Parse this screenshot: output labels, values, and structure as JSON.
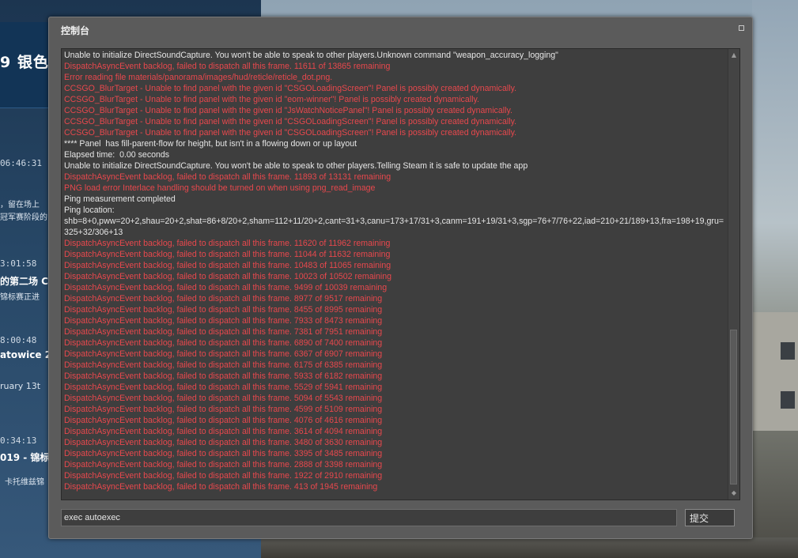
{
  "background": {
    "banner_text": "9 银色",
    "news": [
      {
        "time": "06:46:31",
        "title": "",
        "text": "，留在场上"
      },
      {
        "time": "",
        "title": "",
        "text": "冠军赛阶段的"
      },
      {
        "time": "3:01:58",
        "title": "的第二场 C",
        "text": "锦标赛正进"
      },
      {
        "time": "8:00:48",
        "title": "atowice 2",
        "text": "ruary 13t"
      },
      {
        "time": "0:34:13",
        "title": "019 - 锦标",
        "text": "卡托维兹锦"
      }
    ]
  },
  "console": {
    "title": "控制台",
    "log": [
      {
        "type": "info",
        "text": "Unable to initialize DirectSoundCapture. You won't be able to speak to other players.Unknown command \"weapon_accuracy_logging\""
      },
      {
        "type": "error",
        "text": "DispatchAsyncEvent backlog, failed to dispatch all this frame. 11611 of 13865 remaining"
      },
      {
        "type": "error",
        "text": "Error reading file materials/panorama/images/hud/reticle/reticle_dot.png."
      },
      {
        "type": "error",
        "text": "CCSGO_BlurTarget - Unable to find panel with the given id \"CSGOLoadingScreen\"! Panel is possibly created dynamically."
      },
      {
        "type": "error",
        "text": "CCSGO_BlurTarget - Unable to find panel with the given id \"eom-winner\"! Panel is possibly created dynamically."
      },
      {
        "type": "error",
        "text": "CCSGO_BlurTarget - Unable to find panel with the given id \"JsWatchNoticePanel\"! Panel is possibly created dynamically."
      },
      {
        "type": "error",
        "text": "CCSGO_BlurTarget - Unable to find panel with the given id \"CSGOLoadingScreen\"! Panel is possibly created dynamically."
      },
      {
        "type": "error",
        "text": "CCSGO_BlurTarget - Unable to find panel with the given id \"CSGOLoadingScreen\"! Panel is possibly created dynamically."
      },
      {
        "type": "info",
        "text": "**** Panel  has fill-parent-flow for height, but isn't in a flowing down or up layout"
      },
      {
        "type": "info",
        "text": "Elapsed time:  0.00 seconds"
      },
      {
        "type": "info",
        "text": "Unable to initialize DirectSoundCapture. You won't be able to speak to other players.Telling Steam it is safe to update the app"
      },
      {
        "type": "error",
        "text": "DispatchAsyncEvent backlog, failed to dispatch all this frame. 11893 of 13131 remaining"
      },
      {
        "type": "error",
        "text": "PNG load error Interlace handling should be turned on when using png_read_image"
      },
      {
        "type": "info",
        "text": "Ping measurement completed"
      },
      {
        "type": "info",
        "text": "Ping location:"
      },
      {
        "type": "info",
        "text": "shb=8+0,pww=20+2,shau=20+2,shat=86+8/20+2,sham=112+11/20+2,cant=31+3,canu=173+17/31+3,canm=191+19/31+3,sgp=76+7/76+22,iad=210+21/189+13,fra=198+19,gru=325+32/306+13"
      },
      {
        "type": "error",
        "text": "DispatchAsyncEvent backlog, failed to dispatch all this frame. 11620 of 11962 remaining"
      },
      {
        "type": "error",
        "text": "DispatchAsyncEvent backlog, failed to dispatch all this frame. 11044 of 11632 remaining"
      },
      {
        "type": "error",
        "text": "DispatchAsyncEvent backlog, failed to dispatch all this frame. 10483 of 11065 remaining"
      },
      {
        "type": "error",
        "text": "DispatchAsyncEvent backlog, failed to dispatch all this frame. 10023 of 10502 remaining"
      },
      {
        "type": "error",
        "text": "DispatchAsyncEvent backlog, failed to dispatch all this frame. 9499 of 10039 remaining"
      },
      {
        "type": "error",
        "text": "DispatchAsyncEvent backlog, failed to dispatch all this frame. 8977 of 9517 remaining"
      },
      {
        "type": "error",
        "text": "DispatchAsyncEvent backlog, failed to dispatch all this frame. 8455 of 8995 remaining"
      },
      {
        "type": "error",
        "text": "DispatchAsyncEvent backlog, failed to dispatch all this frame. 7933 of 8473 remaining"
      },
      {
        "type": "error",
        "text": "DispatchAsyncEvent backlog, failed to dispatch all this frame. 7381 of 7951 remaining"
      },
      {
        "type": "error",
        "text": "DispatchAsyncEvent backlog, failed to dispatch all this frame. 6890 of 7400 remaining"
      },
      {
        "type": "error",
        "text": "DispatchAsyncEvent backlog, failed to dispatch all this frame. 6367 of 6907 remaining"
      },
      {
        "type": "error",
        "text": "DispatchAsyncEvent backlog, failed to dispatch all this frame. 6175 of 6385 remaining"
      },
      {
        "type": "error",
        "text": "DispatchAsyncEvent backlog, failed to dispatch all this frame. 5933 of 6182 remaining"
      },
      {
        "type": "error",
        "text": "DispatchAsyncEvent backlog, failed to dispatch all this frame. 5529 of 5941 remaining"
      },
      {
        "type": "error",
        "text": "DispatchAsyncEvent backlog, failed to dispatch all this frame. 5094 of 5543 remaining"
      },
      {
        "type": "error",
        "text": "DispatchAsyncEvent backlog, failed to dispatch all this frame. 4599 of 5109 remaining"
      },
      {
        "type": "error",
        "text": "DispatchAsyncEvent backlog, failed to dispatch all this frame. 4076 of 4616 remaining"
      },
      {
        "type": "error",
        "text": "DispatchAsyncEvent backlog, failed to dispatch all this frame. 3614 of 4094 remaining"
      },
      {
        "type": "error",
        "text": "DispatchAsyncEvent backlog, failed to dispatch all this frame. 3480 of 3630 remaining"
      },
      {
        "type": "error",
        "text": "DispatchAsyncEvent backlog, failed to dispatch all this frame. 3395 of 3485 remaining"
      },
      {
        "type": "error",
        "text": "DispatchAsyncEvent backlog, failed to dispatch all this frame. 2888 of 3398 remaining"
      },
      {
        "type": "error",
        "text": "DispatchAsyncEvent backlog, failed to dispatch all this frame. 1922 of 2910 remaining"
      },
      {
        "type": "error",
        "text": "DispatchAsyncEvent backlog, failed to dispatch all this frame. 413 of 1945 remaining"
      }
    ],
    "input_value": "exec autoexec",
    "submit_label": "提交",
    "colors": {
      "error": "#e8484d",
      "info": "#e6e6e6",
      "window": "#5b5b5b",
      "log_bg": "#3e3e3e"
    }
  }
}
